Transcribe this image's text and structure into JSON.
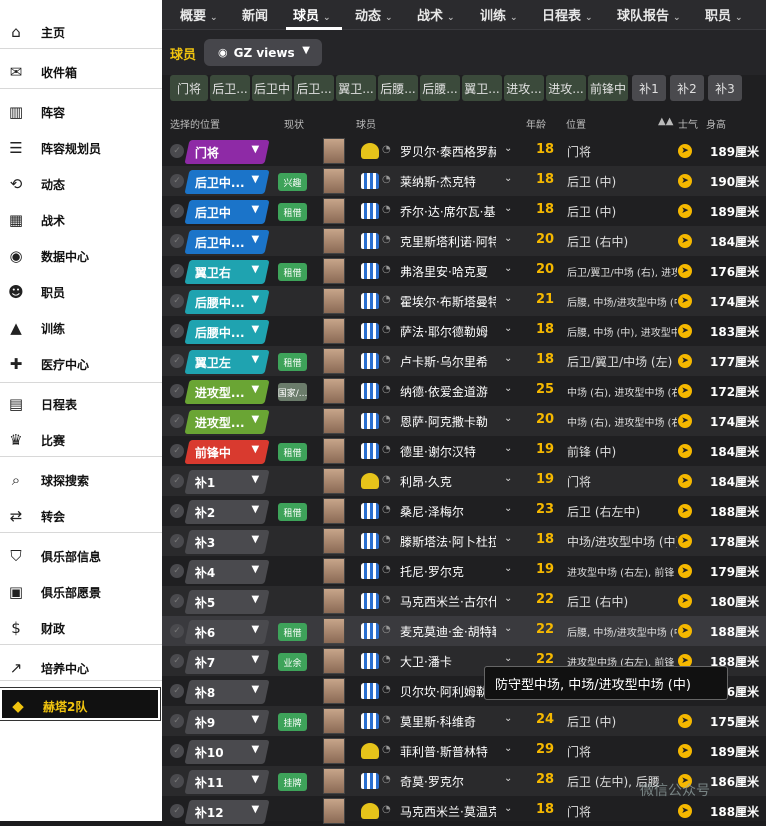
{
  "sidebar": {
    "items": [
      {
        "label": "主页",
        "icon": "home-icon",
        "glyph": "⌂"
      },
      {
        "label": "收件箱",
        "icon": "inbox-icon",
        "glyph": "✉"
      },
      {
        "label": "阵容",
        "icon": "squad-icon",
        "glyph": "▥"
      },
      {
        "label": "阵容规划员",
        "icon": "planner-icon",
        "glyph": "☰"
      },
      {
        "label": "动态",
        "icon": "dynamics-icon",
        "glyph": "⟲"
      },
      {
        "label": "战术",
        "icon": "tactics-icon",
        "glyph": "▦"
      },
      {
        "label": "数据中心",
        "icon": "data-hub-icon",
        "glyph": "◉"
      },
      {
        "label": "职员",
        "icon": "staff-icon",
        "glyph": "☻"
      },
      {
        "label": "训练",
        "icon": "training-icon",
        "glyph": "▲"
      },
      {
        "label": "医疗中心",
        "icon": "medical-icon",
        "glyph": "✚"
      },
      {
        "label": "日程表",
        "icon": "calendar-icon",
        "glyph": "▤"
      },
      {
        "label": "比赛",
        "icon": "trophy-icon",
        "glyph": "♛"
      },
      {
        "label": "球探搜索",
        "icon": "search-icon",
        "glyph": "⌕"
      },
      {
        "label": "转会",
        "icon": "transfer-icon",
        "glyph": "⇄"
      },
      {
        "label": "俱乐部信息",
        "icon": "shield-icon",
        "glyph": "⛉"
      },
      {
        "label": "俱乐部愿景",
        "icon": "briefcase-icon",
        "glyph": "▣"
      },
      {
        "label": "财政",
        "icon": "finance-icon",
        "glyph": "$"
      },
      {
        "label": "培养中心",
        "icon": "development-icon",
        "glyph": "↗"
      },
      {
        "label": "赫塔2队",
        "icon": "team-icon",
        "glyph": "◆"
      }
    ]
  },
  "topnav": {
    "tabs": [
      "概要",
      "新闻",
      "球员",
      "动态",
      "战术",
      "训练",
      "日程表",
      "球队报告",
      "职员"
    ]
  },
  "subbar": {
    "title": "球员",
    "view_label": "GZ views"
  },
  "position_filters": [
    "门将",
    "后卫...",
    "后卫中",
    "后卫...",
    "翼卫...",
    "后腰...",
    "后腰...",
    "翼卫...",
    "进攻...",
    "进攻...",
    "前锋中",
    "补1",
    "补2",
    "补3"
  ],
  "columns": {
    "selected_position": "选择的位置",
    "status": "现状",
    "player": "球员",
    "age": "年龄",
    "position": "位置",
    "morale": "士气",
    "height": "身高"
  },
  "rows": [
    {
      "role": "门将",
      "color": "#8e2aa6",
      "badge": "",
      "kit": "gk",
      "name": "罗贝尔·泰西格罗赫",
      "age": "18",
      "pos": "门将",
      "small": false,
      "height": "189厘米"
    },
    {
      "role": "后卫中...",
      "color": "#1b74c9",
      "badge": "兴趣",
      "kit": "out",
      "name": "莱纳斯·杰克特",
      "age": "18",
      "pos": "后卫 (中)",
      "small": false,
      "height": "190厘米"
    },
    {
      "role": "后卫中",
      "color": "#1b74c9",
      "badge": "租借",
      "kit": "out",
      "name": "乔尔·达·席尔瓦·基亚拉",
      "age": "18",
      "pos": "后卫 (中)",
      "small": false,
      "height": "189厘米"
    },
    {
      "role": "后卫中...",
      "color": "#1b74c9",
      "badge": "",
      "kit": "out",
      "name": "克里斯塔利诺·阿特莫纳",
      "age": "20",
      "pos": "后卫 (右中)",
      "small": false,
      "height": "184厘米"
    },
    {
      "role": "翼卫右",
      "color": "#1fa3b0",
      "badge": "租借",
      "kit": "out",
      "name": "弗洛里安·哈克夏",
      "age": "20",
      "pos": "后卫/翼卫/中场 (右), 进攻型中场 (右)",
      "small": true,
      "height": "176厘米"
    },
    {
      "role": "后腰中...",
      "color": "#1fa3b0",
      "badge": "",
      "kit": "out",
      "name": "霍埃尔·布斯塔曼特",
      "age": "21",
      "pos": "后腰, 中场/进攻型中场 (中)",
      "small": true,
      "height": "174厘米"
    },
    {
      "role": "后腰中...",
      "color": "#1fa3b0",
      "badge": "",
      "kit": "out",
      "name": "萨法·耶尔德勒姆",
      "age": "18",
      "pos": "后腰, 中场 (中), 进攻型中场 (中)",
      "small": true,
      "height": "183厘米"
    },
    {
      "role": "翼卫左",
      "color": "#1fa3b0",
      "badge": "租借",
      "kit": "out",
      "name": "卢卡斯·乌尔里希",
      "age": "18",
      "pos": "后卫/翼卫/中场 (左)",
      "small": false,
      "height": "177厘米"
    },
    {
      "role": "进攻型...",
      "color": "#6aa534",
      "badge": "国家/...",
      "kit": "out",
      "name": "纳德·依爱金道游",
      "age": "25",
      "pos": "中场 (右), 进攻型中场 (右左中), 前锋 (中)",
      "small": true,
      "height": "172厘米"
    },
    {
      "role": "进攻型...",
      "color": "#6aa534",
      "badge": "",
      "kit": "out",
      "name": "恩萨·阿克撒卡勒",
      "age": "20",
      "pos": "中场 (右), 进攻型中场 (右左中)",
      "small": true,
      "height": "174厘米"
    },
    {
      "role": "前锋中",
      "color": "#d93a2f",
      "badge": "租借",
      "kit": "out",
      "name": "德里·谢尔汉特",
      "age": "19",
      "pos": "前锋 (中)",
      "small": false,
      "height": "184厘米"
    },
    {
      "role": "补1",
      "color": "#4a4a4e",
      "badge": "",
      "kit": "gk",
      "name": "利昂·久克",
      "age": "19",
      "pos": "门将",
      "small": false,
      "height": "184厘米"
    },
    {
      "role": "补2",
      "color": "#4a4a4e",
      "badge": "租借",
      "kit": "out",
      "name": "桑尼·泽梅尔",
      "age": "23",
      "pos": "后卫 (右左中)",
      "small": false,
      "height": "188厘米"
    },
    {
      "role": "补3",
      "color": "#4a4a4e",
      "badge": "",
      "kit": "out",
      "name": "滕斯塔法·阿卜杜拉赫曼夫",
      "age": "18",
      "pos": "中场/进攻型中场 (中)",
      "small": false,
      "height": "178厘米"
    },
    {
      "role": "补4",
      "color": "#4a4a4e",
      "badge": "",
      "kit": "out",
      "name": "托尼·罗尔克",
      "age": "19",
      "pos": "进攻型中场 (右左), 前锋 (中)",
      "small": true,
      "height": "179厘米"
    },
    {
      "role": "补5",
      "color": "#4a4a4e",
      "badge": "",
      "kit": "out",
      "name": "马克西米兰·古尔什克",
      "age": "22",
      "pos": "后卫 (右中)",
      "small": false,
      "height": "180厘米"
    },
    {
      "role": "补6",
      "color": "#4a4a4e",
      "badge": "租借",
      "kit": "out",
      "name": "麦克莫迪·金·胡特勒",
      "age": "22",
      "pos": "后腰, 中场/进攻型中场 (中)",
      "small": true,
      "height": "188厘米"
    },
    {
      "role": "补7",
      "color": "#4a4a4e",
      "badge": "业余",
      "kit": "out",
      "name": "大卫·潘卡",
      "age": "22",
      "pos": "进攻型中场 (右左), 前锋 (中)",
      "small": true,
      "height": "188厘米"
    },
    {
      "role": "补8",
      "color": "#4a4a4e",
      "badge": "",
      "kit": "out",
      "name": "贝尔坎·阿利姆勒",
      "age": "",
      "pos": "",
      "small": false,
      "height": "186厘米"
    },
    {
      "role": "补9",
      "color": "#4a4a4e",
      "badge": "挂牌",
      "kit": "out",
      "name": "莫里斯·科维奇",
      "age": "24",
      "pos": "后卫 (中)",
      "small": false,
      "height": "175厘米"
    },
    {
      "role": "补10",
      "color": "#4a4a4e",
      "badge": "",
      "kit": "gk",
      "name": "菲利普·斯普林特",
      "age": "29",
      "pos": "门将",
      "small": false,
      "height": "189厘米"
    },
    {
      "role": "补11",
      "color": "#4a4a4e",
      "badge": "挂牌",
      "kit": "out",
      "name": "奇莫·罗克尔",
      "age": "28",
      "pos": "后卫 (左中), 后腰",
      "small": false,
      "height": "186厘米"
    },
    {
      "role": "补12",
      "color": "#4a4a4e",
      "badge": "",
      "kit": "gk",
      "name": "马克西米兰·莫温克尔",
      "age": "18",
      "pos": "门将",
      "small": false,
      "height": "188厘米"
    }
  ],
  "tooltip": "防守型中场, 中场/进攻型中场 (中)",
  "watermark": "微信公众号"
}
